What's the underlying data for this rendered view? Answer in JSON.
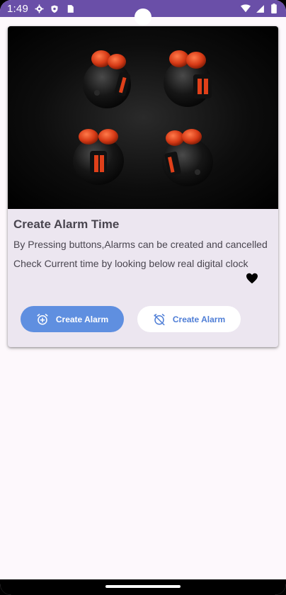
{
  "status_bar": {
    "time": "1:49",
    "left_icons": [
      "gear-icon",
      "shield-icon",
      "sim-card-icon"
    ],
    "right_icons": [
      "wifi-icon",
      "signal-icon",
      "battery-icon"
    ]
  },
  "card": {
    "image": "alarm-clocks-image",
    "title": "Create Alarm Time",
    "description_1": "By Pressing buttons,Alarms can be created and cancelled",
    "description_2": "Check Current time by looking below real digital clock",
    "favorite_icon": "heart-icon"
  },
  "actions": {
    "create_label": "Create Alarm",
    "cancel_label": "Create Alarm"
  },
  "colors": {
    "status_bar": "#6a4fa8",
    "card_bg": "#ece6f0",
    "primary_button": "#5f8fe0",
    "secondary_text": "#4f7ed6"
  }
}
